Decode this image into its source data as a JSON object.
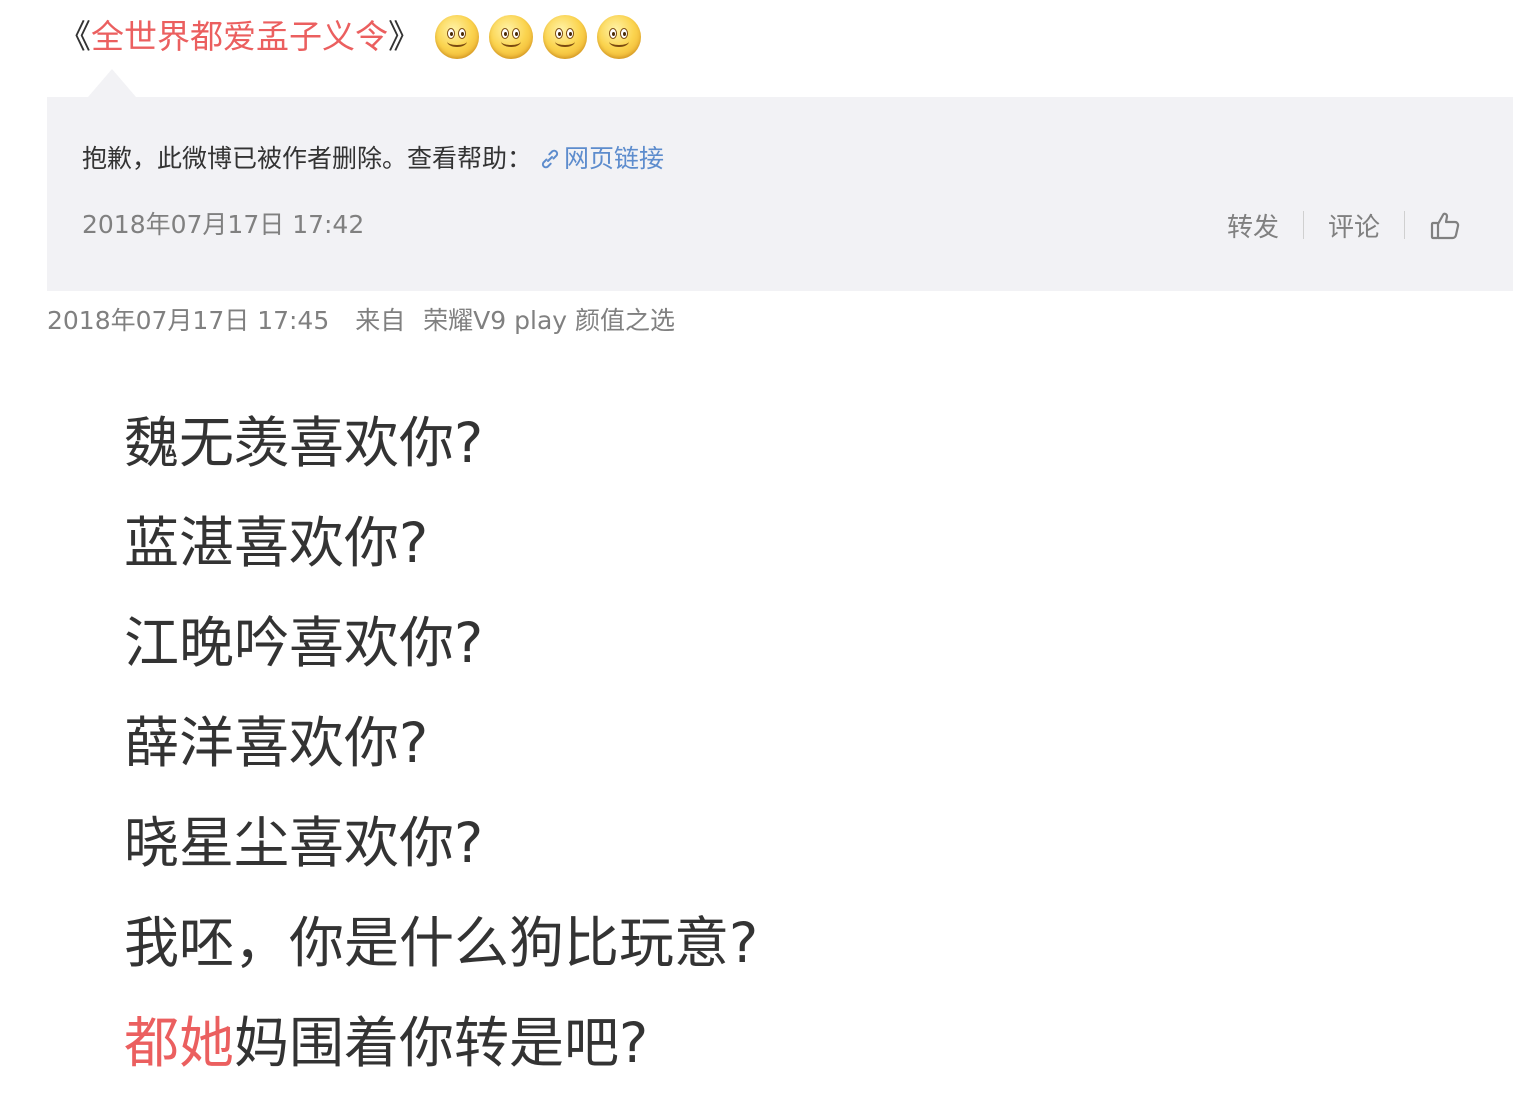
{
  "header": {
    "bracket_open": "《",
    "title": "全世界都爱孟子义令",
    "bracket_close": "》",
    "emojis": [
      "smiley-icon",
      "smiley-icon",
      "smiley-icon",
      "smiley-icon"
    ],
    "link_color": "#eb5f5f"
  },
  "quoted_post": {
    "deleted_message": "抱歉，此微博已被作者删除。查看帮助：",
    "help_link_label": "网页链接",
    "timestamp": "2018年07月17日 17:42",
    "actions": {
      "repost_label": "转发",
      "comment_label": "评论",
      "like_icon": "thumbs-up-icon"
    },
    "background_color": "#f2f2f5",
    "link_color": "#5d8ccd"
  },
  "post": {
    "timestamp": "2018年07月17日 17:45",
    "source_prefix": "来自",
    "source_device": "荣耀V9 play 颜值之选",
    "lines": [
      "魏无羡喜欢你?",
      "蓝湛喜欢你?",
      "江晚吟喜欢你?",
      "薛洋喜欢你?",
      "晓星尘喜欢你?",
      "我呸，你是什么狗比玩意?"
    ],
    "last_line": {
      "highlight": "都她",
      "rest": "妈围着你转是吧?"
    },
    "highlight_color": "#eb5f5f"
  }
}
